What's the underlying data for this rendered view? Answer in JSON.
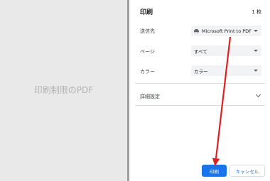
{
  "preview": {
    "text": "印刷制限のPDF"
  },
  "panel": {
    "title": "印刷",
    "count": "1 枚",
    "destination": {
      "label": "送信先",
      "value": "Microsoft Print to PDF",
      "icon": "printer-icon"
    },
    "pages": {
      "label": "ページ",
      "value": "すべて"
    },
    "color": {
      "label": "カラー",
      "value": "カラー"
    },
    "more_settings": {
      "label": "詳細設定"
    },
    "print_button": "印刷",
    "cancel_button": "キャンセル"
  },
  "colors": {
    "accent": "#1a73e8",
    "annotation_arrow": "#e02020"
  }
}
